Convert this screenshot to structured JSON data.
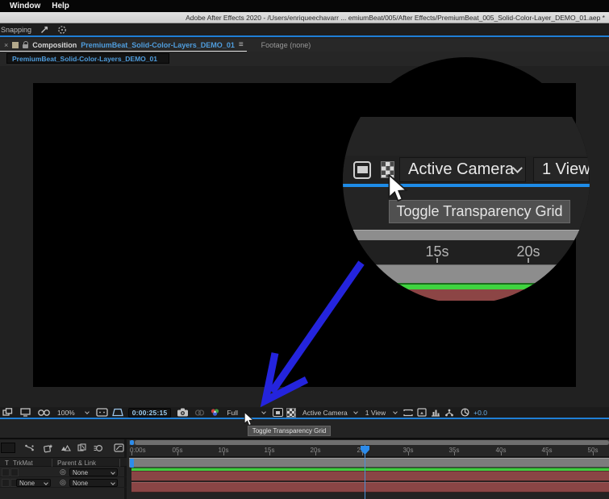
{
  "menubar": {
    "window": "Window",
    "help": "Help"
  },
  "titlebar": {
    "title": "Adobe After Effects 2020 - /Users/enriqueechavarr ... emiumBeat/005/After Effects/PremiumBeat_005_Solid-Color-Layer_DEMO_01.aep *"
  },
  "snapping": {
    "label": "Snapping"
  },
  "tabs": {
    "close": "×",
    "composition_label": "Composition",
    "composition_name": "PremiumBeat_Solid-Color-Layers_DEMO_01",
    "panel_menu": "≡",
    "footage_label": "Footage (none)"
  },
  "comp_tab": {
    "name": "PremiumBeat_Solid-Color-Layers_DEMO_01"
  },
  "callout": {
    "camera_dropdown": "Active Camera",
    "view_dropdown": "1 View",
    "tooltip": "Toggle Transparency Grid",
    "ruler": [
      "15s",
      "20s"
    ]
  },
  "viewer_toolbar": {
    "zoom": "100%",
    "timecode": "0:00:25:15",
    "resolution": "Full",
    "camera": "Active Camera",
    "view": "1 View",
    "exposure": "+0.0",
    "tooltip": "Toggle Transparency Grid"
  },
  "timeline": {
    "header": {
      "t": "T",
      "trkmat": "TrkMat",
      "parent_link": "Parent & Link"
    },
    "rows": [
      {
        "trkmat": "",
        "parent": "None"
      },
      {
        "trkmat": "None",
        "parent": "None"
      }
    ],
    "ruler": [
      "0:00s",
      "05s",
      "10s",
      "15s",
      "20s",
      "25s",
      "30s",
      "35s",
      "40s",
      "45s",
      "50s"
    ]
  },
  "colors": {
    "accent_blue": "#1f7fd6",
    "arrow_blue": "#2424dd",
    "layer_red": "#8a4545",
    "layer_green": "#41cc41",
    "timecode_blue": "#9ccdf0"
  }
}
